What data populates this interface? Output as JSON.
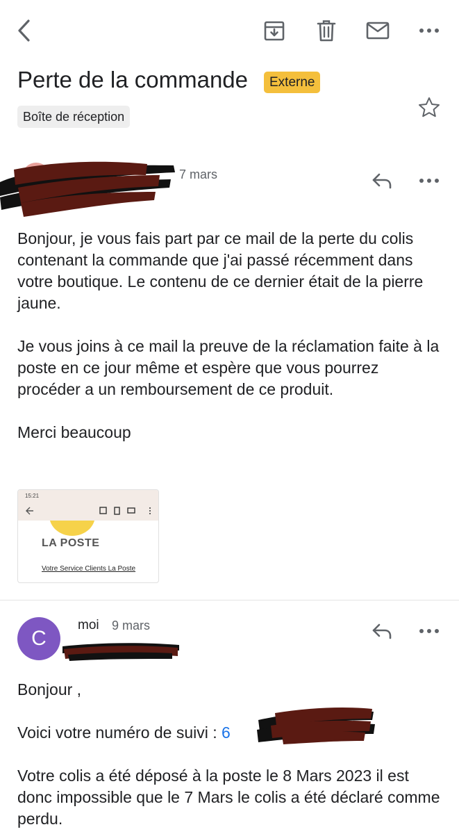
{
  "toolbar": {
    "back_icon": "back-arrow-icon",
    "archive_icon": "archive-icon",
    "delete_icon": "trash-icon",
    "mark_unread_icon": "mail-icon",
    "more_icon": "more-horizontal-icon"
  },
  "thread": {
    "subject": "Perte de la commande",
    "external_label": "Externe",
    "folder_label": "Boîte de réception",
    "star_icon": "star-outline-icon",
    "colors": {
      "external_label_bg": "#f4bf3c",
      "folder_label_bg": "#eeeeee"
    }
  },
  "message1": {
    "date": "7 mars",
    "reply_icon": "reply-icon",
    "more_icon": "more-horizontal-icon",
    "paragraphs": [
      "Bonjour, je vous fais part par ce mail de la perte du colis contenant la commande que j'ai passé récemment dans votre boutique. Le contenu de ce dernier était de la pierre jaune.",
      "Je vous joins à ce mail la preuve de la réclamation faite à la poste en ce jour même et espère que vous pourrez procéder a un remboursement de ce produit.",
      "Merci beaucoup"
    ],
    "attachment": {
      "status_time": "15:21",
      "logo_text": "LA POSTE",
      "link_text": "Votre Service Clients La Poste"
    }
  },
  "message2": {
    "avatar_letter": "C",
    "sender": "moi",
    "date": "9 mars",
    "reply_icon": "reply-icon",
    "more_icon": "more-horizontal-icon",
    "greeting": "Bonjour ,",
    "tracking_label": "Voici votre numéro de suivi :",
    "tracking_visible": "6",
    "paragraph": "Votre colis a été déposé à la poste le 8 Mars 2023 il est donc impossible que le 7 Mars le colis a été déclaré comme perdu.",
    "colors": {
      "avatar_bg": "#7e57c2",
      "link": "#1a73e8"
    }
  }
}
